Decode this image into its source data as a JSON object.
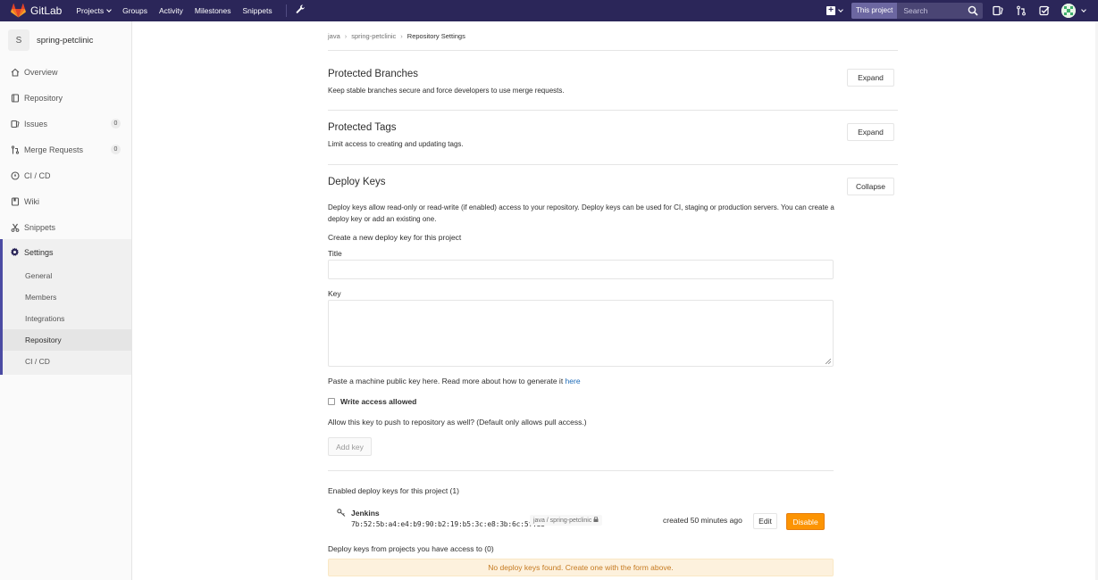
{
  "nav": {
    "brand": "GitLab",
    "links": [
      "Projects",
      "Groups",
      "Activity",
      "Milestones",
      "Snippets"
    ],
    "search_scope": "This project",
    "search_placeholder": "Search"
  },
  "sidebar": {
    "project_initial": "S",
    "project_name": "spring-petclinic",
    "items": [
      {
        "label": "Overview",
        "icon": "home-icon"
      },
      {
        "label": "Repository",
        "icon": "book-icon"
      },
      {
        "label": "Issues",
        "icon": "issues-icon",
        "count": "0"
      },
      {
        "label": "Merge Requests",
        "icon": "merge-request-icon",
        "count": "0"
      },
      {
        "label": "CI / CD",
        "icon": "rocket-icon"
      },
      {
        "label": "Wiki",
        "icon": "wiki-icon"
      },
      {
        "label": "Snippets",
        "icon": "scissors-icon"
      }
    ],
    "settings_label": "Settings",
    "settings_sub": [
      "General",
      "Members",
      "Integrations",
      "Repository",
      "CI / CD"
    ]
  },
  "breadcrumb": [
    "java",
    "spring-petclinic",
    "Repository Settings"
  ],
  "sections": {
    "protected_branches": {
      "title": "Protected Branches",
      "desc": "Keep stable branches secure and force developers to use merge requests.",
      "button": "Expand"
    },
    "protected_tags": {
      "title": "Protected Tags",
      "desc": "Limit access to creating and updating tags.",
      "button": "Expand"
    },
    "deploy_keys": {
      "title": "Deploy Keys",
      "desc": "Deploy keys allow read-only or read-write (if enabled) access to your repository. Deploy keys can be used for CI, staging or production servers. You can create a deploy key or add an existing one.",
      "button": "Collapse",
      "form_heading": "Create a new deploy key for this project",
      "title_label": "Title",
      "title_value": "",
      "key_label": "Key",
      "key_value": "",
      "hint_text": "Paste a machine public key here. Read more about how to generate it ",
      "hint_link": "here",
      "write_access_label": "Write access allowed",
      "write_access_checked": false,
      "write_access_help": "Allow this key to push to repository as well? (Default only allows pull access.)",
      "add_button": "Add key",
      "enabled_heading": "Enabled deploy keys for this project (1)",
      "keys": [
        {
          "title": "Jenkins",
          "fingerprint": "7b:52:5b:a4:e4:b9:90:b2:19:b5:3c:e8:3b:6c:5f:b5",
          "project": "java / spring-petclinic",
          "created": "created 50 minutes ago",
          "edit": "Edit",
          "disable": "Disable"
        }
      ],
      "accessible_heading": "Deploy keys from projects you have access to (0)",
      "empty_message": "No deploy keys found. Create one with the form above."
    }
  },
  "colors": {
    "navbar": "#2b2659",
    "disable_button": "#fc9403",
    "link": "#1b69b6",
    "warning_bg": "#fdf1dd",
    "warning_text": "#c57a21"
  }
}
